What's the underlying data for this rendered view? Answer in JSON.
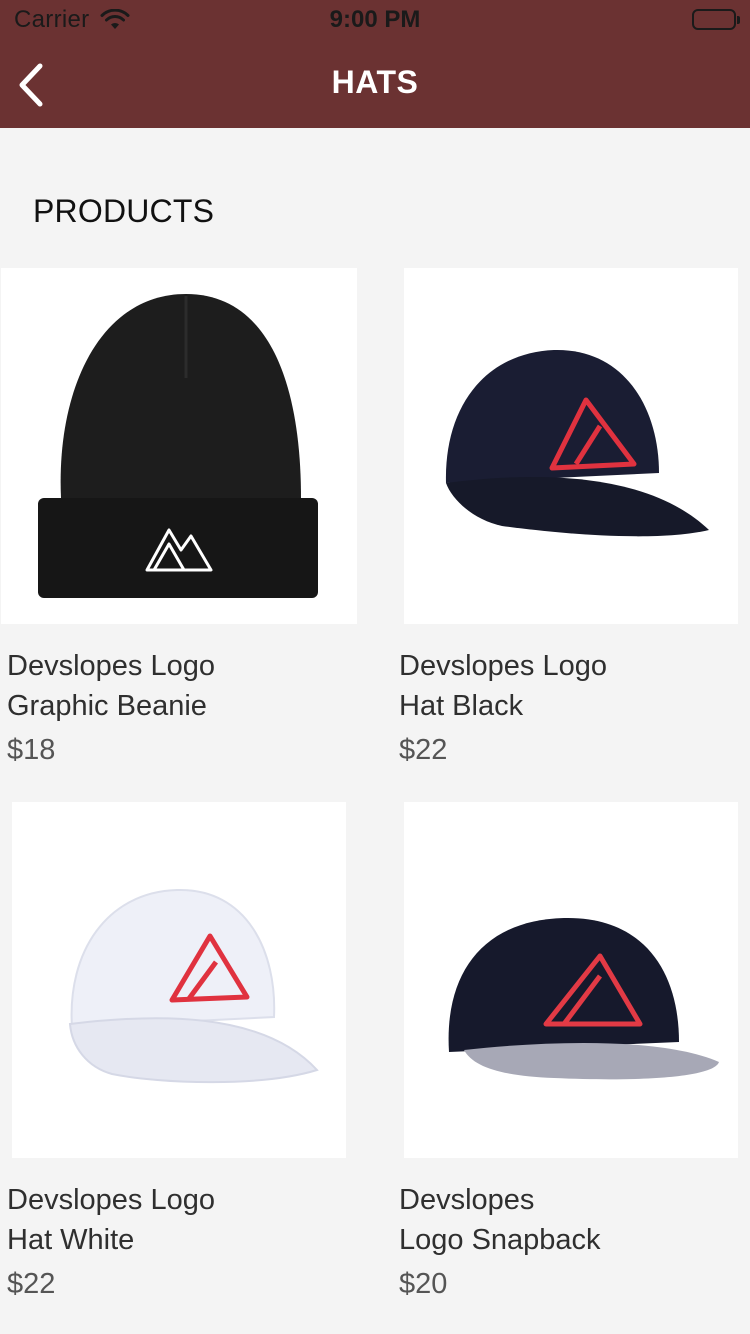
{
  "theme": {
    "brand": "#6b3232",
    "background": "#f4f4f4"
  },
  "status_bar": {
    "carrier": "Carrier",
    "time": "9:00 PM",
    "wifi_icon": "wifi-icon",
    "battery_icon": "battery-icon"
  },
  "nav": {
    "title": "HATS",
    "back_icon": "chevron-left-icon"
  },
  "section": {
    "title": "PRODUCTS"
  },
  "products": [
    {
      "name": "Devslopes Logo\nGraphic Beanie",
      "price": "$18",
      "image": "black-beanie"
    },
    {
      "name": "Devslopes Logo\nHat Black",
      "price": "$22",
      "image": "black-cap"
    },
    {
      "name": "Devslopes Logo\nHat White",
      "price": "$22",
      "image": "white-cap"
    },
    {
      "name": "Devslopes\nLogo Snapback",
      "price": "$20",
      "image": "black-snapback"
    }
  ]
}
